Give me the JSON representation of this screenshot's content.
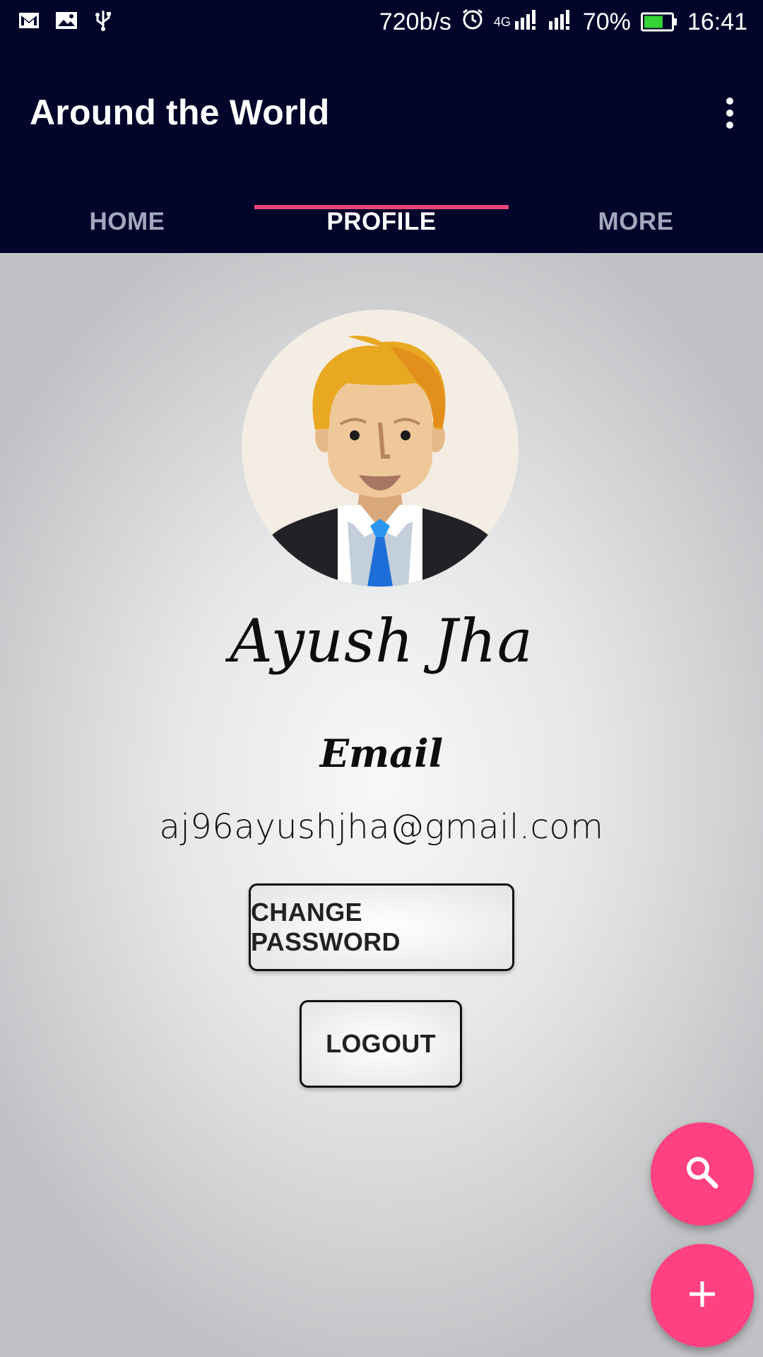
{
  "status_bar": {
    "network_speed": "720b/s",
    "network_type": "4G",
    "battery_percent": "70%",
    "battery_level": 0.7,
    "time": "16:41",
    "left_icons": [
      "gmail-icon",
      "image-icon",
      "usb-icon"
    ],
    "right_icons": [
      "alarm-icon",
      "signal-icon",
      "signal-icon",
      "battery-icon"
    ]
  },
  "app_bar": {
    "title": "Around the World",
    "menu_icon": "more-vert-icon"
  },
  "tabs": [
    {
      "label": "HOME",
      "active": false
    },
    {
      "label": "PROFILE",
      "active": true
    },
    {
      "label": "MORE",
      "active": false
    }
  ],
  "profile": {
    "name": "Ayush Jha",
    "email_label": "Email",
    "email": "aj96ayushjha@gmail.com",
    "change_password_label": "CHANGE PASSWORD",
    "logout_label": "LOGOUT"
  },
  "fabs": [
    {
      "icon": "search-icon"
    },
    {
      "icon": "add-icon"
    }
  ],
  "colors": {
    "app_bar": "#02042a",
    "accent": "#ff4081",
    "tab_indicator": "#e8457a",
    "battery": "#33d433"
  }
}
